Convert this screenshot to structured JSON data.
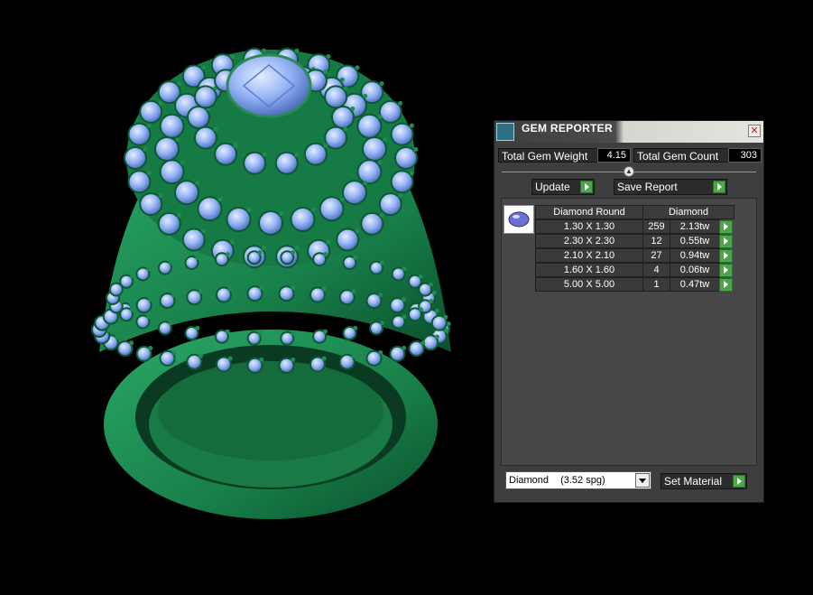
{
  "panel": {
    "title": "GEM REPORTER",
    "close_glyph": "✕",
    "total_weight_label": "Total Gem Weight",
    "total_weight_value": "4.15",
    "total_count_label": "Total Gem Count",
    "total_count_value": "303",
    "slider_glyph": "▲",
    "update_label": "Update",
    "save_report_label": "Save Report",
    "table": {
      "header_size": "Diamond Round",
      "header_material": "Diamond",
      "rows": [
        {
          "size": "1.30 X 1.30",
          "count": "259",
          "weight": "2.13tw"
        },
        {
          "size": "2.30 X 2.30",
          "count": "12",
          "weight": "0.55tw"
        },
        {
          "size": "2.10 X 2.10",
          "count": "27",
          "weight": "0.94tw"
        },
        {
          "size": "1.60 X 1.60",
          "count": "4",
          "weight": "0.06tw"
        },
        {
          "size": "5.00 X 5.00",
          "count": "1",
          "weight": "0.47tw"
        }
      ]
    },
    "material_select": {
      "selected_name": "Diamond",
      "selected_density": "(3.52 spg)"
    },
    "set_material_label": "Set Material"
  },
  "colors": {
    "metal": "#1f8a52",
    "metal_dark": "#0d5a32",
    "gem": "#8fb0f5",
    "gem_light": "#c9d9ff",
    "go_button": "#4da64a"
  },
  "icons": [
    "gem-reporter-icon",
    "close-icon",
    "slider-knob-icon",
    "arrow-right-icon",
    "round-gem-icon",
    "chevron-down-icon"
  ]
}
